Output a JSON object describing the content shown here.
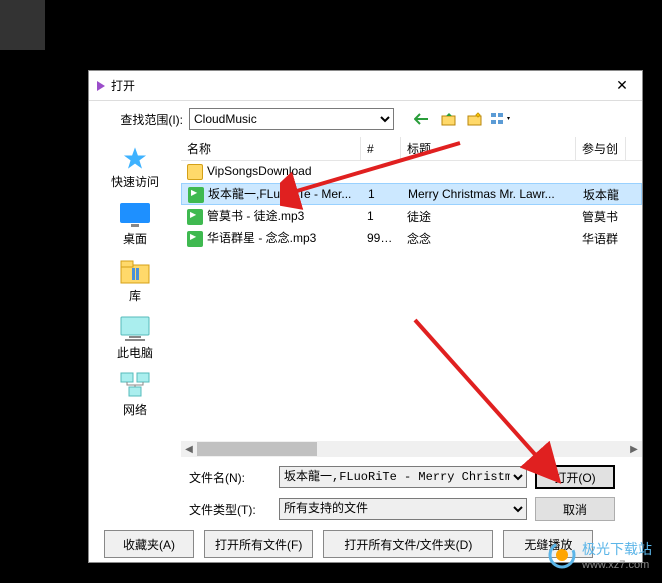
{
  "window": {
    "title": "打开",
    "close": "✕"
  },
  "lookin": {
    "label": "查找范围(I):",
    "value": "CloudMusic"
  },
  "places": [
    {
      "key": "quick",
      "label": "快速访问"
    },
    {
      "key": "desktop",
      "label": "桌面"
    },
    {
      "key": "library",
      "label": "库"
    },
    {
      "key": "thispc",
      "label": "此电脑"
    },
    {
      "key": "network",
      "label": "网络"
    }
  ],
  "columns": {
    "name": "名称",
    "num": "#",
    "title": "标题",
    "artist": "参与创"
  },
  "files": [
    {
      "type": "folder",
      "name": "VipSongsDownload",
      "num": "",
      "title": "",
      "artist": "",
      "selected": false
    },
    {
      "type": "audio",
      "name": "坂本龍一,FLuoRiTe - Mer...",
      "num": "1",
      "title": "Merry Christmas Mr. Lawr...",
      "artist": "坂本龍",
      "selected": true
    },
    {
      "type": "audio",
      "name": "管莫书 - 徒途.mp3",
      "num": "1",
      "title": "徒途",
      "artist": "管莫书",
      "selected": false
    },
    {
      "type": "audio",
      "name": "华语群星 - 念念.mp3",
      "num": "999...",
      "title": "念念",
      "artist": "华语群",
      "selected": false
    }
  ],
  "filename": {
    "label": "文件名(N):",
    "value": "坂本龍一,FLuoRiTe - Merry Christmas Mr"
  },
  "filetype": {
    "label": "文件类型(T):",
    "value": "所有支持的文件"
  },
  "buttons": {
    "open": "打开(O)",
    "cancel": "取消"
  },
  "bottombar": {
    "fav": "收藏夹(A)",
    "openall": "打开所有文件(F)",
    "openallfolder": "打开所有文件/文件夹(D)",
    "seamless": "无缝播放"
  },
  "watermark": {
    "brand": "极光下载站",
    "url": "www.xz7.com"
  }
}
